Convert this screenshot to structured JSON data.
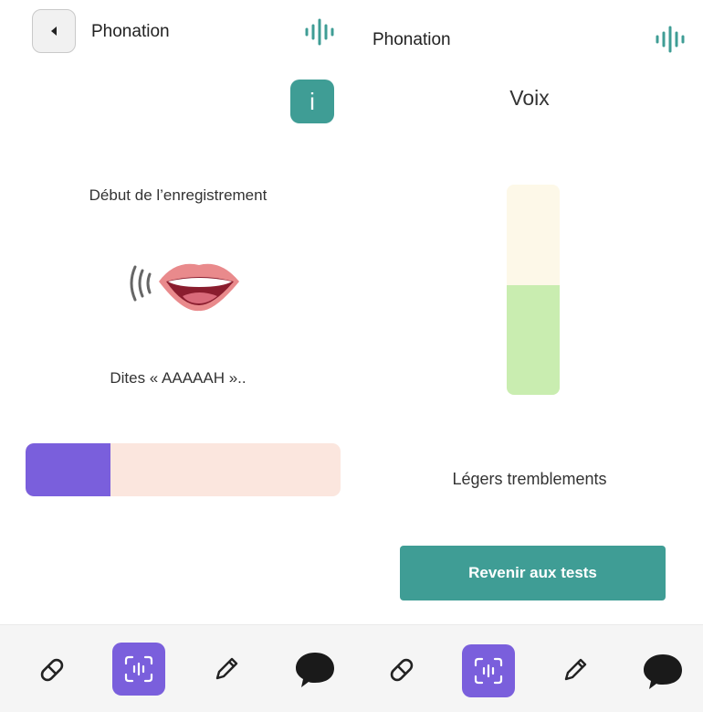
{
  "colors": {
    "accent_teal": "#3f9d95",
    "accent_purple": "#7a5fdc",
    "progress_track": "#fbe6de",
    "meter_bg": "#fdf8e8",
    "meter_fill": "#c9edb0"
  },
  "left_screen": {
    "title": "Phonation",
    "icons": {
      "back": "back-arrow-icon",
      "wave": "sound-wave-icon",
      "info": "info-icon",
      "mouth": "mouth-speaking-icon"
    },
    "info_label": "i",
    "heading": "Début de l’enregistrement",
    "instruction": "Dites « AAAAAH »..",
    "progress_fraction": 0.27
  },
  "right_screen": {
    "title": "Phonation",
    "icons": {
      "wave": "sound-wave-icon"
    },
    "voice_title": "Voix",
    "meter_fraction": 0.52,
    "result_label": "Légers tremblements",
    "back_button_label": "Revenir aux tests"
  },
  "bottom_nav": {
    "items": [
      {
        "icon": "pill-icon",
        "active": false
      },
      {
        "icon": "scan-voice-icon",
        "active": true
      },
      {
        "icon": "pencil-icon",
        "active": false
      },
      {
        "icon": "chat-bubble-icon",
        "active": false
      }
    ]
  }
}
